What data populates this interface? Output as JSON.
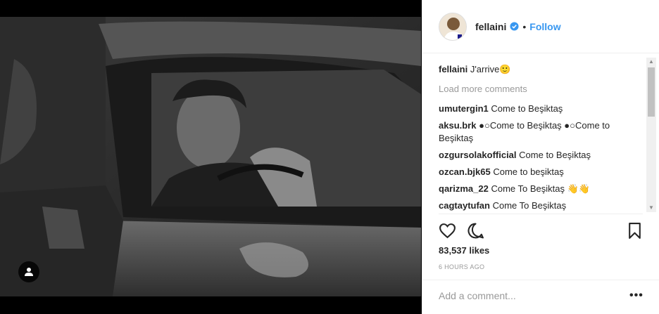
{
  "post": {
    "username": "fellaini",
    "follow_label": "Follow",
    "separator": "•",
    "caption_user": "fellaini",
    "caption_text": "J'arrive🙂",
    "load_more": "Load more comments",
    "comments": [
      {
        "user": "umutergin1",
        "text": "Come to Beşiktaş"
      },
      {
        "user": "aksu.brk",
        "text": "●○Come to Beşiktaş ●○Come to Beşiktaş"
      },
      {
        "user": "ozgursolakofficial",
        "text": "Come to Beşiktaş"
      },
      {
        "user": "ozcan.bjk65",
        "text": "Come to beşiktaş"
      },
      {
        "user": "qarizma_22",
        "text": "Come To Beşiktaş 👋👋"
      },
      {
        "user": "cagtaytufan",
        "text": "Come To Beşiktaş"
      }
    ],
    "likes": "83,537 likes",
    "time": "6 HOURS AGO",
    "add_comment_placeholder": "Add a comment...",
    "more_options": "•••"
  },
  "colors": {
    "link_blue": "#3897f0",
    "verified_blue": "#3897f0",
    "muted_gray": "#999999"
  },
  "icons": {
    "verified": "verified-badge-icon",
    "like": "heart-icon",
    "comment": "comment-bubble-icon",
    "save": "bookmark-icon",
    "user_tag": "user-tag-icon"
  }
}
